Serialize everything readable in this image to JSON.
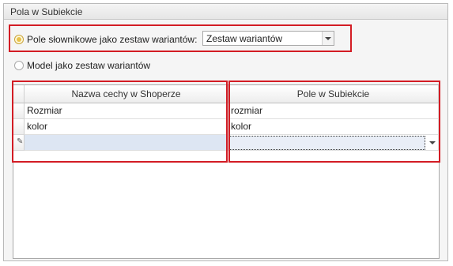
{
  "group": {
    "title": "Pola w Subiekcie"
  },
  "options": {
    "dictionary": {
      "label": "Pole słownikowe jako zestaw wariantów:",
      "checked": true
    },
    "model": {
      "label": "Model jako zestaw wariantów",
      "checked": false
    }
  },
  "combo": {
    "value": "Zestaw wariantów"
  },
  "grid": {
    "columns": [
      "Nazwa cechy w Shoperze",
      "Pole w Subiekcie"
    ],
    "rows": [
      {
        "shoper": "Rozmiar",
        "subiekt": "rozmiar"
      },
      {
        "shoper": "kolor",
        "subiekt": "kolor"
      }
    ],
    "new_row_indicator": "pencil-icon"
  },
  "colors": {
    "highlight": "#d31c24",
    "radio_selected": "#e8c24c",
    "new_row": "#dde6f3"
  }
}
